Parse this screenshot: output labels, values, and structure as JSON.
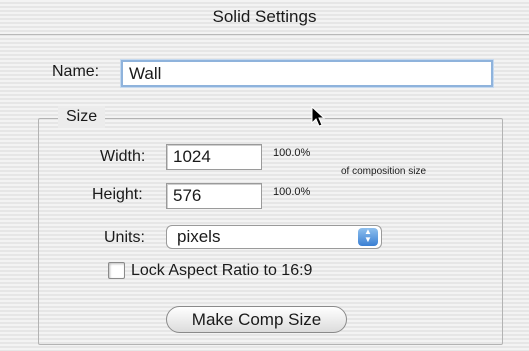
{
  "dialog": {
    "title": "Solid Settings"
  },
  "name": {
    "label": "Name:",
    "value": "Wall"
  },
  "size_group": {
    "legend": "Size",
    "width_label": "Width:",
    "width_value": "1024",
    "width_percent": "100.0%",
    "height_label": "Height:",
    "height_value": "576",
    "height_percent": "100.0%",
    "of_comp_note": "of composition size"
  },
  "units": {
    "label": "Units:",
    "selected": "pixels"
  },
  "lock_aspect": {
    "label": "Lock Aspect Ratio to 16:9",
    "checked": false
  },
  "make_comp_button": {
    "label": "Make Comp Size"
  },
  "icons": [
    "up-down-arrows-icon",
    "mouse-pointer-icon"
  ]
}
